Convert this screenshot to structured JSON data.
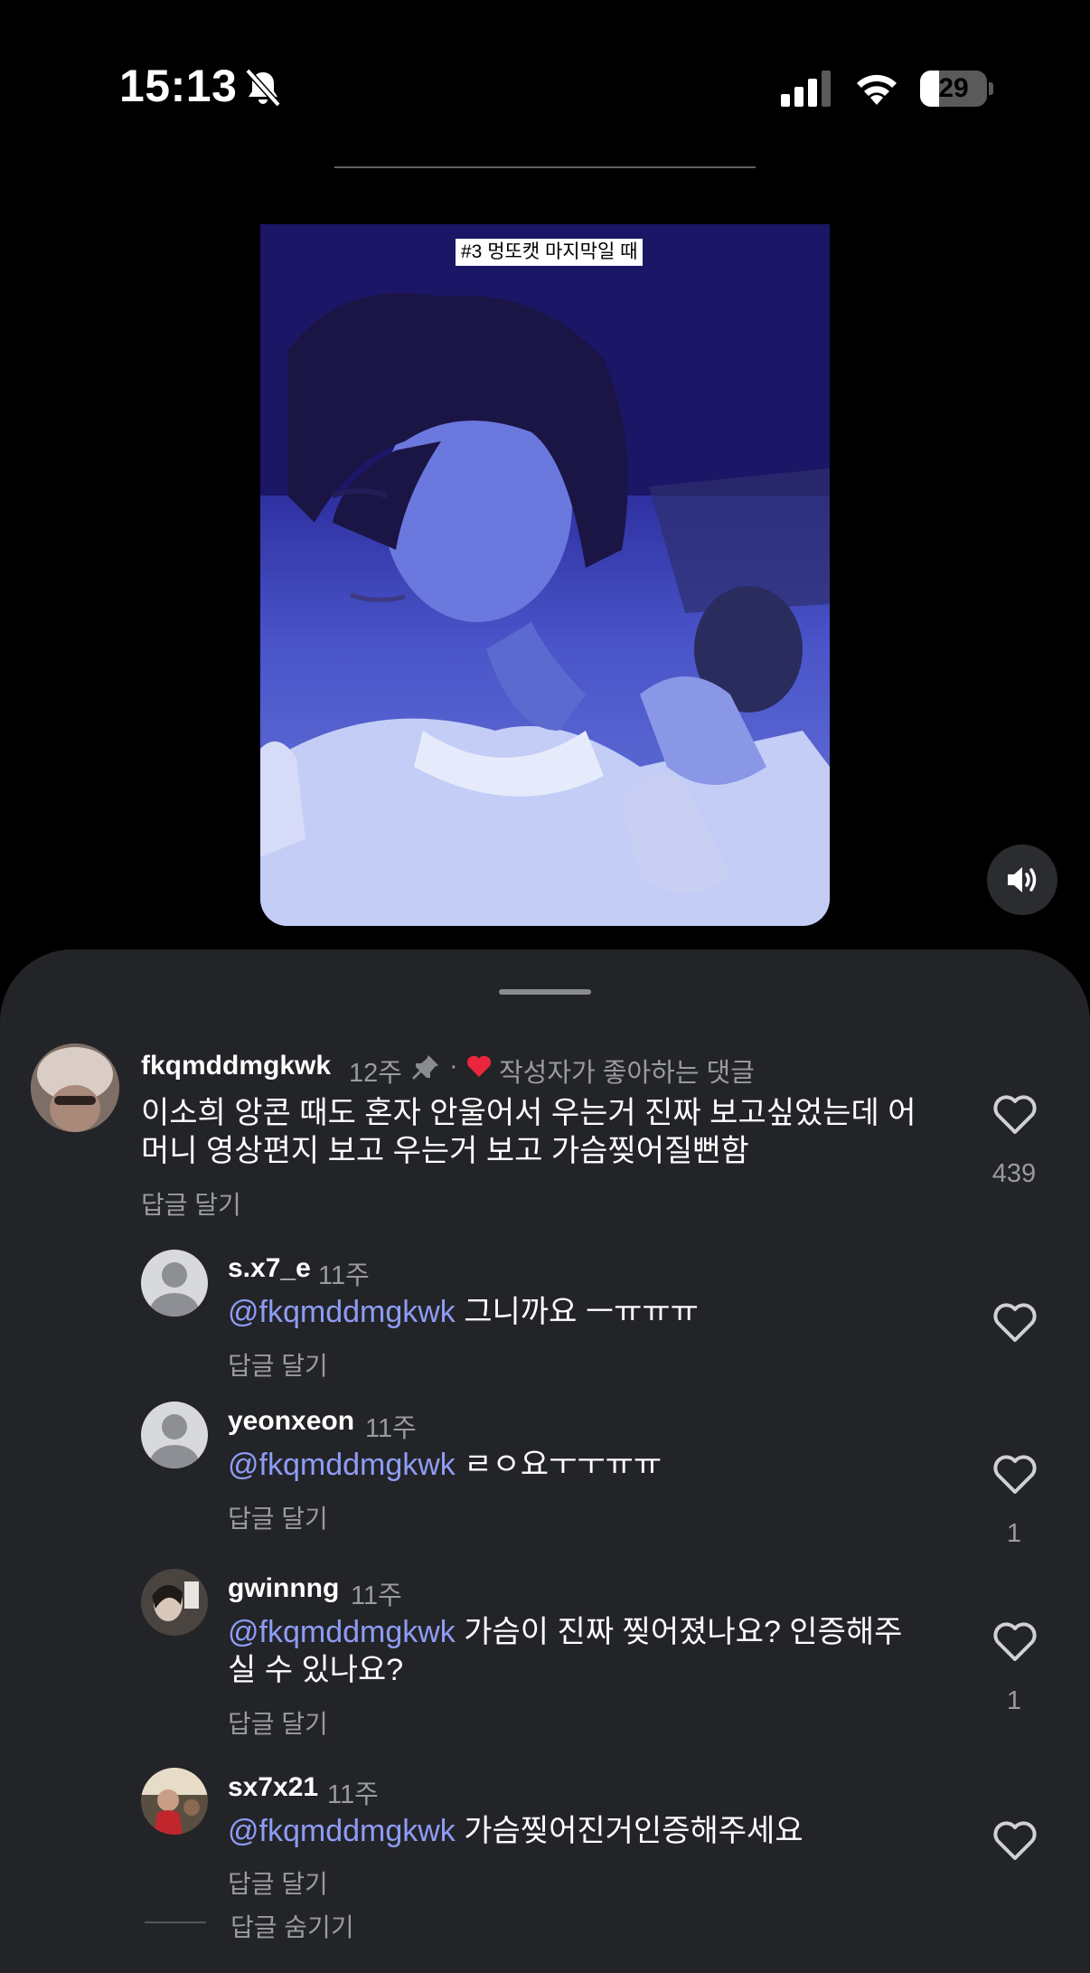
{
  "status_bar": {
    "time": "15:13",
    "battery": "29",
    "battery_level": 0.29
  },
  "video": {
    "caption": "#3 멍또캣 마지막일 때"
  },
  "main_comment": {
    "username": "fkqmddmgkwk",
    "age": "12주",
    "creator_liked": "작성자가 좋아하는 댓글",
    "text": "이소희 앙콘 때도 혼자 안울어서 우는거 진짜 보고싶었는데 어머니 영상편지 보고 우는거 보고 가슴찢어질뻔함",
    "reply_label": "답글 달기",
    "likes": "439"
  },
  "replies": [
    {
      "username": "s.x7_e",
      "age": "11주",
      "mention": "@fkqmddmgkwk",
      "text": "그니까요 ㅡㅠㅠㅠ",
      "reply_label": "답글 달기",
      "likes": ""
    },
    {
      "username": "yeonxeon",
      "age": "11주",
      "mention": "@fkqmddmgkwk",
      "text": "ㄹㅇ요ㅜㅜㅠㅠ",
      "reply_label": "답글 달기",
      "likes": "1"
    },
    {
      "username": "gwinnng",
      "age": "11주",
      "mention": "@fkqmddmgkwk",
      "text": "가슴이 진짜 찢어졌나요? 인증해주",
      "text2": "실 수 있나요?",
      "reply_label": "답글 달기",
      "likes": "1"
    },
    {
      "username": "sx7x21",
      "age": "11주",
      "mention": "@fkqmddmgkwk",
      "text": "가슴찢어진거인증해주세요",
      "reply_label": "답글 달기",
      "likes": ""
    }
  ],
  "hide_replies": "답글 숨기기",
  "colors": {
    "sheet": "#232428",
    "mention": "#8e9cf5",
    "muted": "#9a9ba0",
    "liked_heart": "#e8273c"
  }
}
